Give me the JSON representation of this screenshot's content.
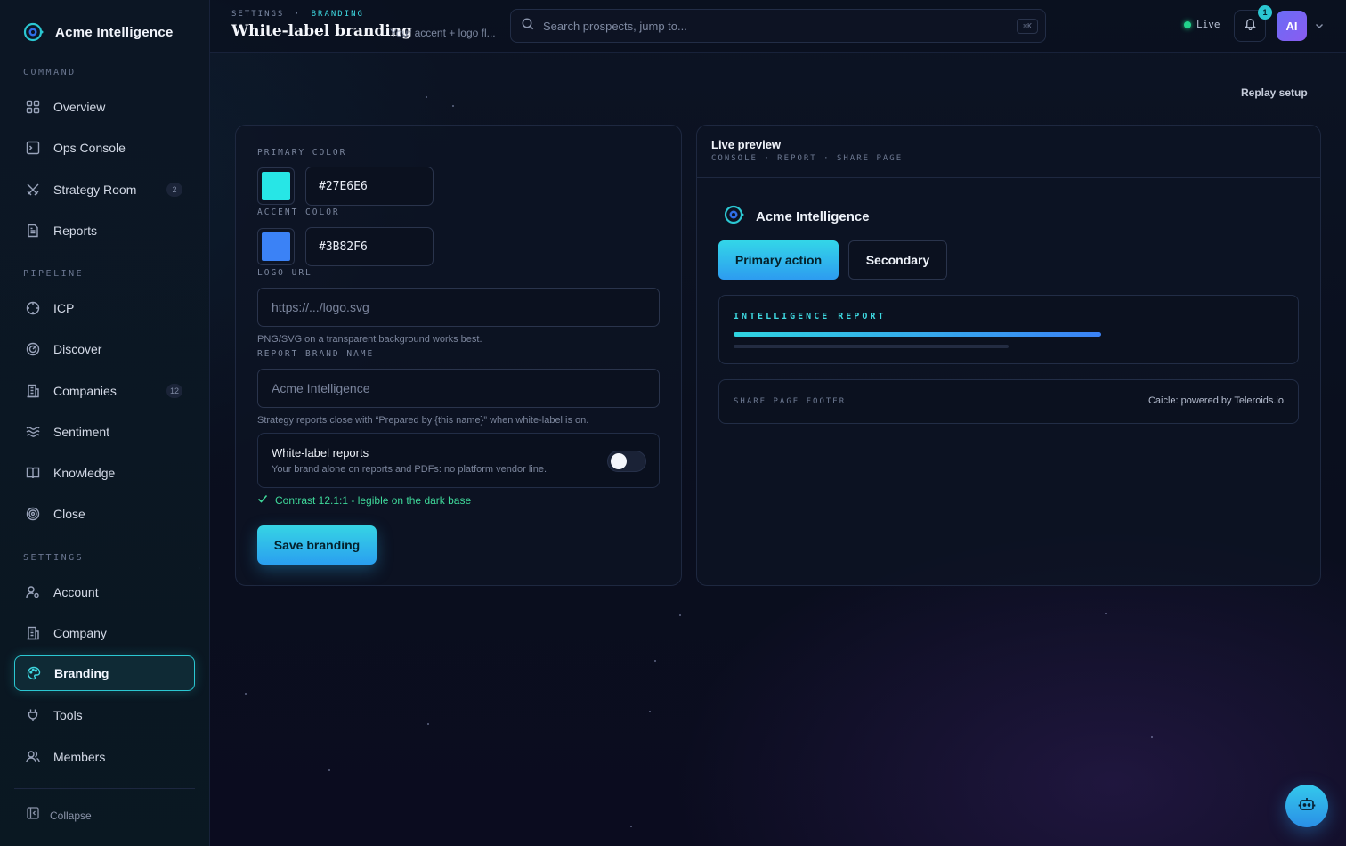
{
  "app": {
    "name": "Acme Intelligence"
  },
  "sidebar": {
    "sections": [
      {
        "label": "COMMAND"
      },
      {
        "label": "PIPELINE"
      },
      {
        "label": "SETTINGS"
      }
    ],
    "items": [
      {
        "label": "Overview",
        "icon": "grid-icon"
      },
      {
        "label": "Ops Console",
        "icon": "terminal-icon"
      },
      {
        "label": "Strategy Room",
        "icon": "swords-icon",
        "badge": "2"
      },
      {
        "label": "Reports",
        "icon": "document-icon"
      },
      {
        "label": "ICP",
        "icon": "crosshair-icon"
      },
      {
        "label": "Discover",
        "icon": "radar-icon"
      },
      {
        "label": "Companies",
        "icon": "building-icon",
        "badge": "12"
      },
      {
        "label": "Sentiment",
        "icon": "waves-icon"
      },
      {
        "label": "Knowledge",
        "icon": "book-icon"
      },
      {
        "label": "Close",
        "icon": "target-icon"
      },
      {
        "label": "Account",
        "icon": "user-cog-icon"
      },
      {
        "label": "Company",
        "icon": "building-icon"
      },
      {
        "label": "Branding",
        "icon": "palette-icon",
        "active": true
      },
      {
        "label": "Tools",
        "icon": "plug-icon"
      },
      {
        "label": "Members",
        "icon": "users-icon"
      }
    ],
    "collapse_label": "Collapse"
  },
  "header": {
    "breadcrumb_parent": "SETTINGS",
    "breadcrumb_sep": "·",
    "breadcrumb_current": "BRANDING",
    "title": "White-label branding",
    "subtitle": "Your accent + logo fl...",
    "search_placeholder": "Search prospects, jump to...",
    "search_shortcut": "⌘K",
    "status_label": "Live",
    "notification_count": "1",
    "avatar_initials": "AI"
  },
  "replay_label": "Replay setup",
  "form": {
    "primary_color_label": "PRIMARY COLOR",
    "primary_color_value": "#27E6E6",
    "accent_color_label": "ACCENT COLOR",
    "accent_color_value": "#3B82F6",
    "logo_url_label": "LOGO URL",
    "logo_url_placeholder": "https://.../logo.svg",
    "logo_hint": "PNG/SVG on a transparent background works best.",
    "brand_name_label": "REPORT BRAND NAME",
    "brand_name_placeholder": "Acme Intelligence",
    "brand_name_hint": "Strategy reports close with “Prepared by {this name}” when white-label is on.",
    "whitelabel_title": "White-label reports",
    "whitelabel_desc": "Your brand alone on reports and PDFs: no platform vendor line.",
    "whitelabel_on": false,
    "contrast_text": "Contrast 12.1:1 - legible on the dark base",
    "save_label": "Save branding"
  },
  "preview": {
    "title": "Live preview",
    "subtitle": "CONSOLE · REPORT · SHARE PAGE",
    "brand_name": "Acme Intelligence",
    "primary_button": "Primary action",
    "secondary_button": "Secondary",
    "report_label": "INTELLIGENCE REPORT",
    "footer_label": "SHARE PAGE FOOTER",
    "footer_text": "Caicle: powered by Teleroids.io"
  },
  "colors": {
    "primary": "#27E6E6",
    "accent": "#3B82F6",
    "live_status": "#22D38B"
  }
}
